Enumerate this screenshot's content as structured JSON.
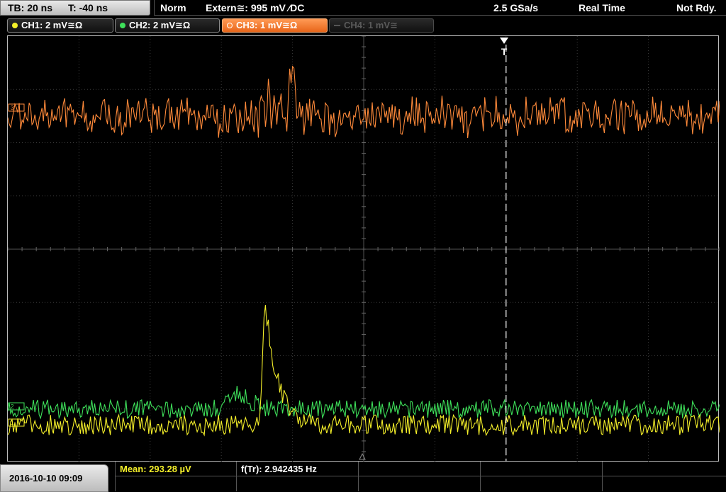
{
  "topbar": {
    "timebase": "TB: 20 ns",
    "trigger_offset": "T: -40 ns",
    "trigger_mode": "Norm",
    "trigger_source": "Extern≅: 995 mV ⁄DC",
    "sample_rate": "2.5 GSa/s",
    "acquisition_mode": "Real Time",
    "status": "Not Rdy."
  },
  "channels": [
    {
      "label": "CH1: 2 mV≅Ω",
      "color": "#f5f02a",
      "state": "on"
    },
    {
      "label": "CH2: 2 mV≅Ω",
      "color": "#3ee05a",
      "state": "on"
    },
    {
      "label": "CH3: 1 mV≅Ω",
      "color": "#ff8a3a",
      "state": "selected"
    },
    {
      "label": "CH4: 1 mV≅",
      "color": "#555555",
      "state": "off"
    }
  ],
  "trigger_marker": "T",
  "datetime": "2016-10-10 09:09",
  "measurements": {
    "mean_label": "Mean: 293.28 µV",
    "freq_label": "f(Tr): 2.942435 Hz"
  },
  "waveforms": {
    "ch3_baseline_div": 1.5,
    "ch1_baseline_div": 7.3,
    "ch2_baseline_div": 7.0,
    "ch1_pulse_peak_div": 4.9,
    "ch1_pulse_time_div": 3.6,
    "trigger_time_div": 7.0
  },
  "colors": {
    "ch1": "#f5f02a",
    "ch2": "#3ee05a",
    "ch3": "#ff8a3a",
    "grid": "#4a4a4a"
  }
}
